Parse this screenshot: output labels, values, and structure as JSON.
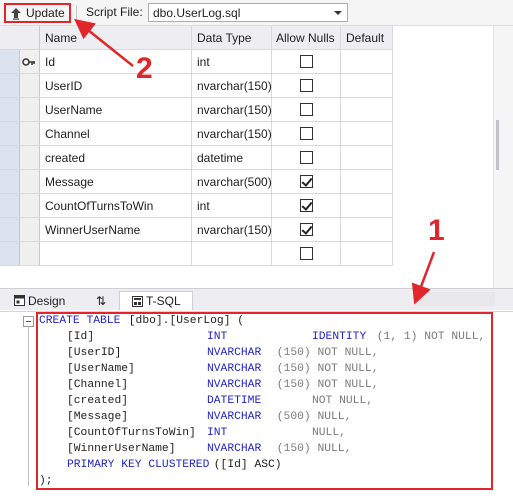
{
  "toolbar": {
    "update_label": "Update",
    "script_file_label": "Script File:",
    "script_file_value": "dbo.UserLog.sql"
  },
  "grid": {
    "headers": {
      "name": "Name",
      "type": "Data Type",
      "nulls": "Allow Nulls",
      "default": "Default"
    },
    "rows": [
      {
        "name": "Id",
        "type": "int",
        "nulls": false,
        "key": true
      },
      {
        "name": "UserID",
        "type": "nvarchar(150)",
        "nulls": false
      },
      {
        "name": "UserName",
        "type": "nvarchar(150)",
        "nulls": false
      },
      {
        "name": "Channel",
        "type": "nvarchar(150)",
        "nulls": false
      },
      {
        "name": "created",
        "type": "datetime",
        "nulls": false
      },
      {
        "name": "Message",
        "type": "nvarchar(500)",
        "nulls": true
      },
      {
        "name": "CountOfTurnsToWin",
        "type": "int",
        "nulls": true
      },
      {
        "name": "WinnerUserName",
        "type": "nvarchar(150)",
        "nulls": true
      },
      {
        "name": "",
        "type": "",
        "nulls": false
      }
    ]
  },
  "tabs": {
    "design": "Design",
    "tsql": "T-SQL"
  },
  "sql": {
    "l1_kw": "CREATE TABLE",
    "l1_tx": " [dbo].[UserLog] (",
    "lines": [
      {
        "col": "[Id]",
        "type": "INT",
        "extra_kw": "IDENTITY",
        "extra": " (1, 1) NOT NULL,"
      },
      {
        "col": "[UserID]",
        "type": "NVARCHAR",
        "extra": " (150) NOT NULL,"
      },
      {
        "col": "[UserName]",
        "type": "NVARCHAR",
        "extra": " (150) NOT NULL,"
      },
      {
        "col": "[Channel]",
        "type": "NVARCHAR",
        "extra": " (150) NOT NULL,"
      },
      {
        "col": "[created]",
        "type": "DATETIME",
        "extra": "NOT NULL,"
      },
      {
        "col": "[Message]",
        "type": "NVARCHAR",
        "extra": " (500) NULL,"
      },
      {
        "col": "[CountOfTurnsToWin]",
        "type": "INT",
        "extra": "NULL,"
      },
      {
        "col": "[WinnerUserName]",
        "type": "NVARCHAR",
        "extra": " (150) NULL,"
      }
    ],
    "pk_kw": "PRIMARY KEY CLUSTERED",
    "pk_tx": " ([Id] ASC)",
    "end": ");"
  },
  "annotations": {
    "one": "1",
    "two": "2"
  },
  "colors": {
    "annotation": "#e0262b",
    "keyword": "#2424c8"
  }
}
